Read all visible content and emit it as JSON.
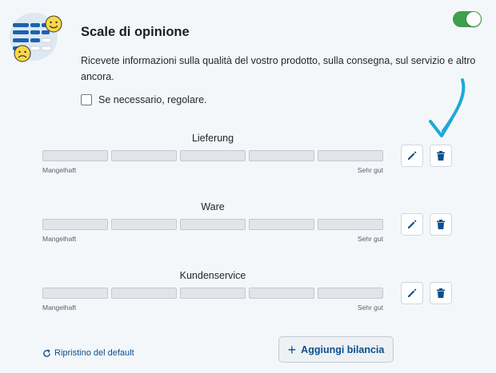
{
  "header": {
    "title": "Scale di opinione",
    "toggle_on": true
  },
  "description": "Ricevete informazioni sulla qualità del vostro prodotto, sulla consegna, sul servizio e altro ancora.",
  "adjust_option": {
    "label": "Se necessario, regolare.",
    "checked": false
  },
  "scales": [
    {
      "title": "Lieferung",
      "min_label": "Mangelhaft",
      "max_label": "Sehr gut",
      "segments": 5
    },
    {
      "title": "Ware",
      "min_label": "Mangelhaft",
      "max_label": "Sehr gut",
      "segments": 5
    },
    {
      "title": "Kundenservice",
      "min_label": "Mangelhaft",
      "max_label": "Sehr gut",
      "segments": 5
    }
  ],
  "icons": {
    "edit": "pencil-icon",
    "delete": "trash-icon",
    "reset": "reset-icon"
  },
  "footer": {
    "reset_label": "Ripristino del default",
    "add_label": "Aggiungi bilancia"
  },
  "colors": {
    "accent": "#0b4f8c",
    "toggle": "#3f9f4a",
    "annotation_arrow": "#1fa8d8"
  }
}
